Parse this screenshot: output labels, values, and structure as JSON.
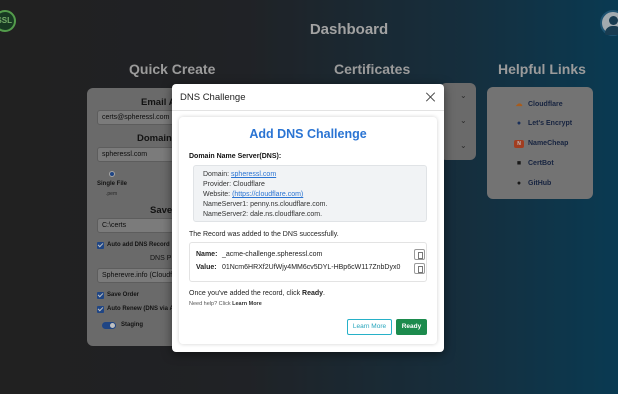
{
  "header": {
    "logo_text": "SSL",
    "title": "Dashboard"
  },
  "sections": {
    "quick_create": "Quick Create",
    "certificates": "Certificates",
    "helpful_links": "Helpful Links"
  },
  "quick_create": {
    "email_label": "Email A",
    "email_value": "certs@spheressl.com",
    "domain_label": "Domain A",
    "domain_value": "spheressl.com",
    "single_file_label": "Single File",
    "pem_label": ".pem",
    "save_label": "Save",
    "save_path": "C:\\certs",
    "auto_add_dns": "Auto add DNS Record",
    "dns_provider_label": "DNS P",
    "dns_provider_value": "Spherevre.info (Cloudfla",
    "save_order": "Save Order",
    "auto_renew": "Auto Renew (DNS via A",
    "staging": "Staging"
  },
  "helpful_links": [
    {
      "label": "Cloudflare",
      "icon": "cloud-icon"
    },
    {
      "label": "Let's Encrypt",
      "icon": "lock-icon"
    },
    {
      "label": "NameCheap",
      "icon": "namecheap-icon"
    },
    {
      "label": "CertBot",
      "icon": "robot-icon"
    },
    {
      "label": "GitHub",
      "icon": "github-icon"
    }
  ],
  "modal": {
    "title": "DNS Challenge",
    "heading": "Add DNS Challenge",
    "server_heading": "Domain Name Server(DNS):",
    "domain_label": "Domain:",
    "domain_value": "spheressl.com",
    "provider_label": "Provider:",
    "provider_value": "Cloudflare",
    "website_label": "Website:",
    "website_value": "(https://cloudflare.com)",
    "ns1_label": "NameServer1:",
    "ns1_value": "penny.ns.cloudflare.com.",
    "ns2_label": "NameServer2:",
    "ns2_value": "dale.ns.cloudflare.com.",
    "success_text": "The Record was added to the DNS successfully.",
    "record_name_label": "Name:",
    "record_name_value": "_acme-challenge.spheressl.com",
    "record_value_label": "Value:",
    "record_value_value": "01Ncm6HRXf2UfWjy4MM6cv5DYL-HBp6cW117ZnbDyx0",
    "once_text_before": "Once you've added the record, click",
    "once_text_bold": "Ready",
    "once_text_after": ".",
    "help_prefix": "Need help? Click",
    "help_link": "Learn More",
    "learn_more_button": "Learn More",
    "ready_button": "Ready"
  },
  "colors": {
    "accent_blue": "#2a74d3",
    "ready_green": "#1c8b4d",
    "learn_teal": "#27b1c8"
  }
}
